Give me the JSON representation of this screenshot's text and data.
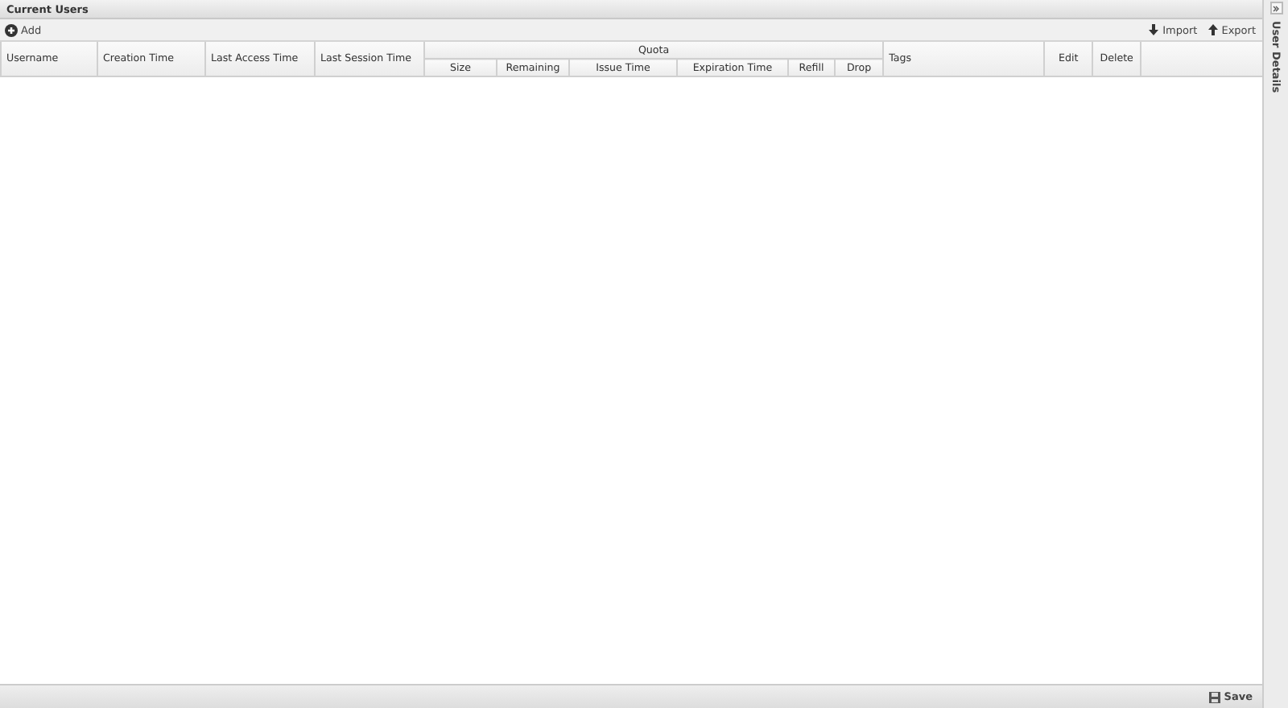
{
  "panel": {
    "title": "Current Users"
  },
  "toolbar": {
    "left": [
      {
        "label": "Add"
      }
    ],
    "right": [
      {
        "label": "Import"
      },
      {
        "label": "Export"
      }
    ]
  },
  "table": {
    "columns": [
      {
        "label": "Username"
      },
      {
        "label": "Creation Time"
      },
      {
        "label": "Last Access Time"
      },
      {
        "label": "Last Session Time"
      },
      {
        "label": "Quota",
        "children": [
          {
            "label": "Size"
          },
          {
            "label": "Remaining"
          },
          {
            "label": "Issue Time"
          },
          {
            "label": "Expiration Time"
          },
          {
            "label": "Refill"
          },
          {
            "label": "Drop"
          }
        ]
      },
      {
        "label": "Tags"
      },
      {
        "label": "Edit"
      },
      {
        "label": "Delete"
      }
    ]
  },
  "sidebar": {
    "title": "User Details",
    "collapsed": true
  },
  "footer": {
    "buttons": [
      {
        "label": "Save"
      }
    ]
  }
}
